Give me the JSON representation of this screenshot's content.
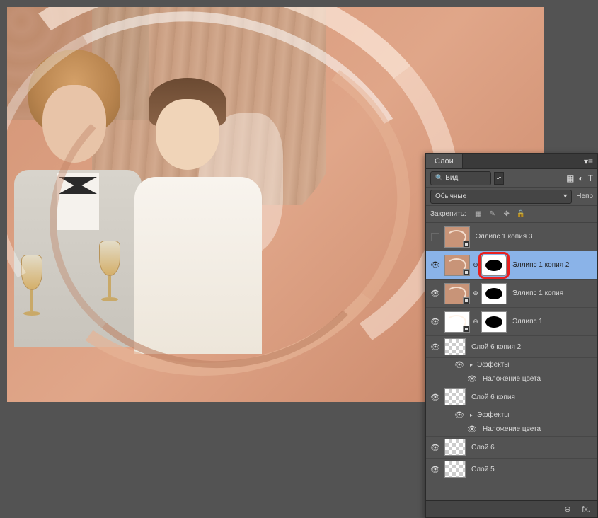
{
  "panel": {
    "tab": "Слои",
    "filter_kind": "Вид",
    "blend_mode": "Обычные",
    "opacity_label": "Непр",
    "lock_label": "Закрепить:"
  },
  "layers": [
    {
      "name": "Эллипс 1 копия 3",
      "visible": false,
      "has_mask": false,
      "selected": false,
      "thumb": "peach-smart"
    },
    {
      "name": "Эллипс 1 копия 2",
      "visible": true,
      "has_mask": true,
      "selected": true,
      "thumb": "peach-smart",
      "mask_highlighted": true
    },
    {
      "name": "Эллипс 1 копия",
      "visible": true,
      "has_mask": true,
      "selected": false,
      "thumb": "peach-smart"
    },
    {
      "name": "Эллипс 1",
      "visible": true,
      "has_mask": true,
      "selected": false,
      "thumb": "white-smart"
    },
    {
      "name": "Слой 6 копия 2",
      "visible": true,
      "has_mask": false,
      "selected": false,
      "thumb": "checker",
      "compact": true,
      "effects": {
        "label": "Эффекты",
        "items": [
          "Наложение цвета"
        ]
      }
    },
    {
      "name": "Слой 6 копия",
      "visible": true,
      "has_mask": false,
      "selected": false,
      "thumb": "checker",
      "compact": true,
      "effects": {
        "label": "Эффекты",
        "items": [
          "Наложение цвета"
        ]
      }
    },
    {
      "name": "Слой 6",
      "visible": true,
      "has_mask": false,
      "selected": false,
      "thumb": "checker",
      "compact": true
    },
    {
      "name": "Слой 5",
      "visible": true,
      "has_mask": false,
      "selected": false,
      "thumb": "checker",
      "compact": true
    }
  ],
  "bottom_icons": {
    "link": "⊖",
    "fx": "fx."
  }
}
